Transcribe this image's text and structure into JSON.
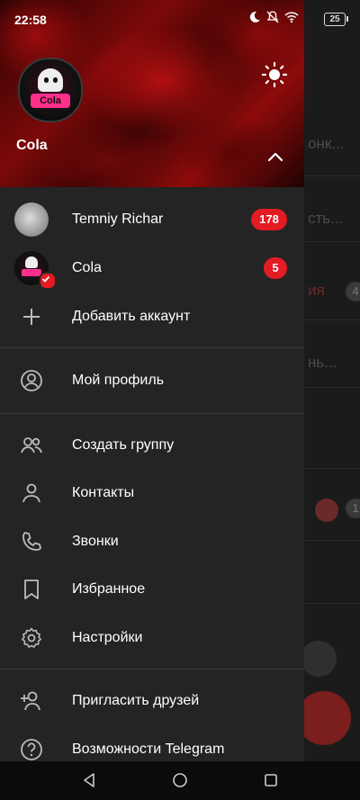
{
  "status_bar": {
    "time": "22:58",
    "battery": "25"
  },
  "profile": {
    "name": "Cola",
    "avatar_text": "Cola"
  },
  "accounts": [
    {
      "name": "Temniy Richar",
      "badge": "178"
    },
    {
      "name": "Cola",
      "badge": "5"
    }
  ],
  "menu": {
    "add_account": "Добавить аккаунт",
    "my_profile": "Мой профиль",
    "create_group": "Создать группу",
    "contacts": "Контакты",
    "calls": "Звонки",
    "saved": "Избранное",
    "settings": "Настройки",
    "invite_friends": "Пригласить друзей",
    "telegram_features": "Возможности Telegram"
  },
  "background": {
    "snippets": [
      "онк...",
      "сть...",
      "ия",
      "нь..."
    ],
    "counts": [
      "4",
      "1"
    ]
  },
  "colors": {
    "accent": "#e31b23",
    "drawer_bg": "#242424",
    "header_red": "#8e0b0b"
  },
  "icons": [
    "moon-icon",
    "mute-bell-icon",
    "wifi-icon",
    "sun-icon",
    "chevron-up-icon",
    "plus-icon",
    "profile-icon",
    "group-icon",
    "contacts-icon",
    "phone-icon",
    "bookmark-icon",
    "settings-gear-icon",
    "invite-icon",
    "help-icon",
    "back-icon",
    "home-icon",
    "recents-icon"
  ]
}
